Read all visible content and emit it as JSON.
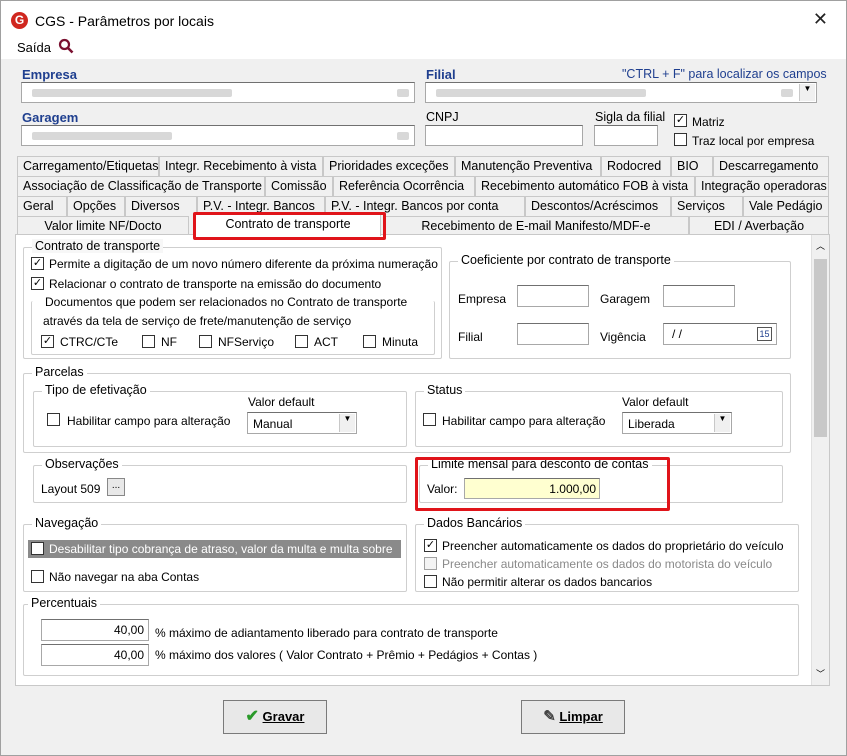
{
  "app": {
    "title": "CGS - Parâmetros por locais",
    "logo_letter": "G"
  },
  "menu": {
    "exit": "Saída"
  },
  "header": {
    "empresa_label": "Empresa",
    "filial_label": "Filial",
    "ctrl_f_hint": "\"CTRL + F\" para localizar os campos",
    "garagem_label": "Garagem",
    "cnpj_label": "CNPJ",
    "sigla_filial_label": "Sigla da filial",
    "matriz_label": "Matriz",
    "traz_local_label": "Traz local por empresa"
  },
  "tabs_row1": [
    "Carregamento/Etiquetas",
    "Integr. Recebimento à vista",
    "Prioridades exceções",
    "Manutenção Preventiva",
    "Rodocred",
    "BIO",
    "Descarregamento"
  ],
  "tabs_row2": [
    "Associação de Classificação de Transporte",
    "Comissão",
    "Referência Ocorrência",
    "Recebimento automático FOB à vista",
    "Integração operadoras"
  ],
  "tabs_row3": [
    "Geral",
    "Opções",
    "Diversos",
    "P.V. - Integr. Bancos",
    "P.V. - Integr. Bancos por conta",
    "Descontos/Acréscimos",
    "Serviços",
    "Vale Pedágio"
  ],
  "tabs_row4": [
    "Valor limite NF/Docto",
    "Contrato de transporte",
    "Recebimento de E-mail Manifesto/MDF-e",
    "EDI / Averbação"
  ],
  "contrato": {
    "group_title": "Contrato de transporte",
    "permite": "Permite a digitação de um novo número diferente da próxima numeração",
    "relacionar": "Relacionar o contrato de transporte na emissão do documento",
    "docs_title_1": "Documentos que podem ser relacionados no Contrato de transporte",
    "docs_title_2": "através da tela de serviço de frete/manutenção de serviço",
    "doc_ctrc": "CTRC/CTe",
    "doc_nf": "NF",
    "doc_nfservico": "NFServiço",
    "doc_act": "ACT",
    "doc_minuta": "Minuta"
  },
  "coeficiente": {
    "title": "Coeficiente por contrato de transporte",
    "empresa": "Empresa",
    "garagem": "Garagem",
    "filial": "Filial",
    "vigencia": "Vigência",
    "vigencia_value": "/ /",
    "cal_icon": "15"
  },
  "parcelas": {
    "title": "Parcelas",
    "tipo_title": "Tipo de efetivação",
    "habilitar": "Habilitar campo para alteração",
    "valor_default": "Valor default",
    "tipo_value": "Manual",
    "status_title": "Status",
    "status_habilitar": "Habilitar campo para alteração",
    "status_valor_default": "Valor default",
    "status_value": "Liberada"
  },
  "observacoes": {
    "title": "Observações",
    "layout": "Layout 509",
    "btn": "..."
  },
  "limite": {
    "title": "Limite mensal para desconto de contas",
    "valor_label": "Valor:",
    "valor": "1.000,00"
  },
  "navegacao": {
    "title": "Navegação",
    "desabilitar": "Desabilitar tipo cobrança de atraso, valor da multa e multa sobre",
    "nao_navegar": "Não navegar na aba Contas"
  },
  "dados_bancarios": {
    "title": "Dados Bancários",
    "prop": "Preencher automaticamente os dados do proprietário do veículo",
    "mot": "Preencher automaticamente os dados do motorista do veículo",
    "nao_permitir": "Não permitir alterar os dados bancarios"
  },
  "percentuais": {
    "title": "Percentuais",
    "v1": "40,00",
    "l1": "% máximo de adiantamento liberado para contrato de transporte",
    "v2": "40,00",
    "l2": "% máximo dos valores ( Valor Contrato + Prêmio + Pedágios + Contas )"
  },
  "buttons": {
    "gravar": "Gravar",
    "limpar": "Limpar"
  },
  "colors": {
    "accent_red": "#e0141a",
    "label_blue": "#1f3f8f",
    "highlight_input": "#ffffd0"
  }
}
